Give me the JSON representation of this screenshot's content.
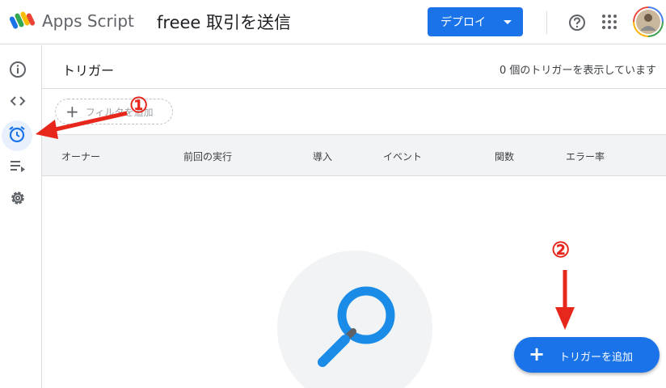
{
  "header": {
    "app_name": "Apps Script",
    "project_title": "freee 取引を送信",
    "deploy_label": "デプロイ"
  },
  "rail": {
    "items": [
      "overview-icon",
      "editor-icon",
      "triggers-icon",
      "executions-icon",
      "settings-icon"
    ],
    "active": "triggers-icon"
  },
  "main": {
    "title": "トリガー",
    "count_text": "0 個のトリガーを表示しています",
    "filter_label": "フィルタを追加",
    "columns": [
      "オーナー",
      "前回の実行",
      "導入",
      "イベント",
      "関数",
      "エラー率"
    ],
    "fab_label": "トリガーを追加"
  },
  "annotations": {
    "marker_1": "①",
    "marker_2": "②"
  },
  "colors": {
    "primary": "#1a73e8",
    "annotation": "#e8271c",
    "table_header": "#f1f3f4"
  }
}
